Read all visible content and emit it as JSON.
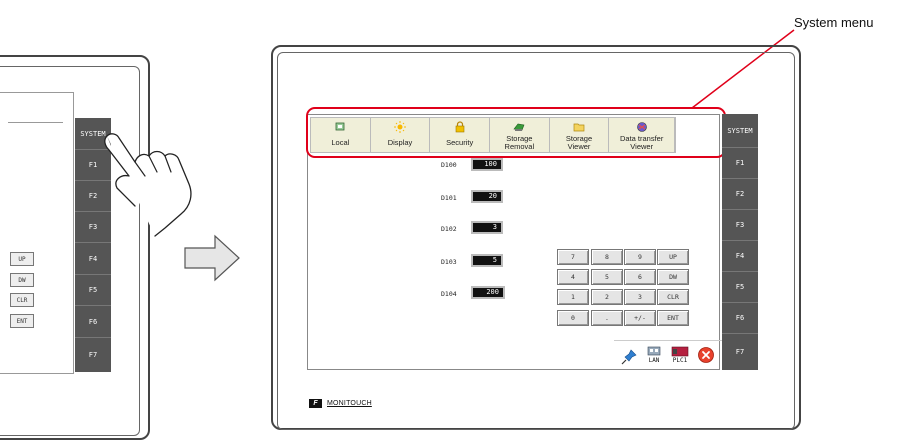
{
  "callout": {
    "label": "System menu"
  },
  "left_panel": {
    "function_keys": [
      "SYSTEM",
      "F1",
      "F2",
      "F3",
      "F4",
      "F5",
      "F6",
      "F7"
    ],
    "small_keys": [
      "UP",
      "DW",
      "CLR",
      "ENT"
    ]
  },
  "system_menu": {
    "items": [
      {
        "label": "Local",
        "icon": "local-icon"
      },
      {
        "label": "Display",
        "icon": "display-icon"
      },
      {
        "label": "Security",
        "icon": "lock-icon"
      },
      {
        "label": "Storage\nRemoval",
        "icon": "storage-removal-icon"
      },
      {
        "label": "Storage\nViewer",
        "icon": "folder-icon"
      },
      {
        "label": "Data transfer\nViewer",
        "icon": "data-transfer-icon"
      }
    ]
  },
  "registers": [
    {
      "label": "D100",
      "value": "100"
    },
    {
      "label": "D101",
      "value": "20"
    },
    {
      "label": "D102",
      "value": "3"
    },
    {
      "label": "D103",
      "value": "5"
    },
    {
      "label": "D104",
      "value": "200"
    }
  ],
  "keypad": [
    [
      "7",
      "8",
      "9",
      "UP"
    ],
    [
      "4",
      "5",
      "6",
      "DW"
    ],
    [
      "1",
      "2",
      "3",
      "CLR"
    ],
    [
      "0",
      ".",
      "+/-",
      "ENT"
    ]
  ],
  "function_keys": [
    "SYSTEM",
    "F1",
    "F2",
    "F3",
    "F4",
    "F5",
    "F6",
    "F7"
  ],
  "status_icons": {
    "lan_label": "LAN",
    "plc_label": "PLC1"
  },
  "brand": {
    "name": "MONITOUCH",
    "logo_text": "F"
  },
  "colors": {
    "highlight": "#e0001a",
    "menu_bg": "#f0efd9",
    "fkey_bg": "#555555"
  }
}
